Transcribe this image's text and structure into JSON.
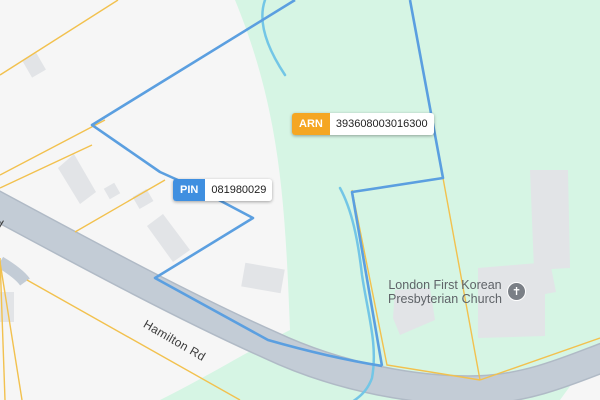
{
  "map": {
    "colors": {
      "background": "#f6f6f6",
      "green_area": "#d6f5e4",
      "road": "#c3ccd6",
      "road_edge": "#b0bac6",
      "parcel_lines": "#f2c14e",
      "selected_boundary": "#5b9fe0",
      "water": "#73c6e6",
      "building": "#e2e4e7"
    },
    "roads": [
      {
        "name": "Hamilton Rd"
      },
      {
        "name": "d"
      }
    ],
    "places": [
      {
        "name_line1": "London First Korean",
        "name_line2": "Presbyterian Church",
        "icon": "church-cross-icon"
      }
    ]
  },
  "chips": {
    "pin": {
      "tag": "PIN",
      "value": "081980029",
      "tag_color": "#3f8fe0"
    },
    "arn": {
      "tag": "ARN",
      "value": "393608003016300",
      "tag_color": "#f5a623"
    }
  }
}
